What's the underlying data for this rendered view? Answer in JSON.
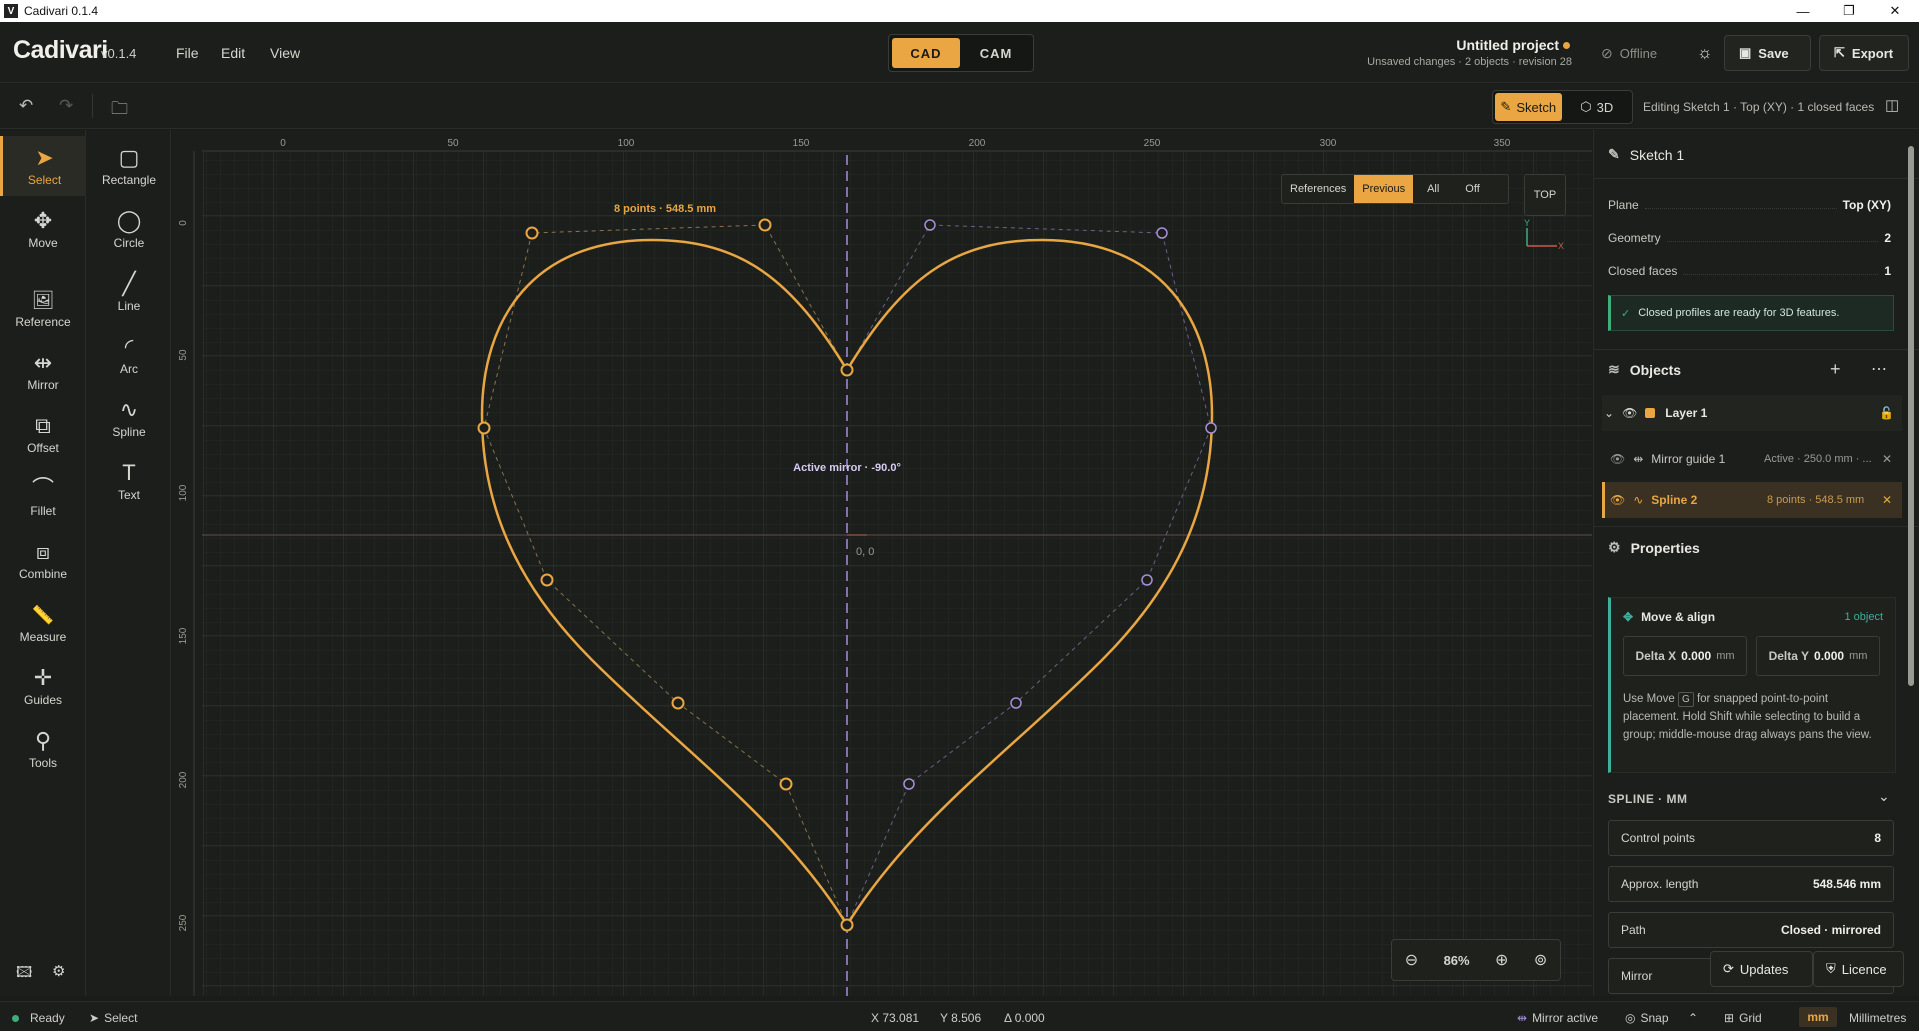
{
  "window": {
    "title": "Cadivari 0.1.4",
    "logo_letter": "V"
  },
  "app": {
    "name": "Cadivari",
    "version": "v0.1.4"
  },
  "menu": [
    "File",
    "Edit",
    "View"
  ],
  "mode": {
    "cad": "CAD",
    "cam": "CAM"
  },
  "project": {
    "title": "Untitled project",
    "subtitle": "Unsaved changes · 2 objects · revision 28"
  },
  "header_actions": {
    "offline": "Offline",
    "save": "Save",
    "export": "Export"
  },
  "view_switch": {
    "sketch": "Sketch",
    "three_d": "3D"
  },
  "editing_status": "Editing Sketch 1 · Top (XY) · 1 closed faces",
  "tools_primary": [
    {
      "label": "Select",
      "icon": "cursor-icon",
      "glyph": "➤"
    },
    {
      "label": "Move",
      "icon": "move-icon",
      "glyph": "✥"
    },
    {
      "label": "Reference",
      "icon": "image-add-icon",
      "glyph": "🖼"
    },
    {
      "label": "Mirror",
      "icon": "mirror-icon",
      "glyph": "⇹"
    },
    {
      "label": "Offset",
      "icon": "offset-icon",
      "glyph": "⧉"
    },
    {
      "label": "Fillet",
      "icon": "fillet-icon",
      "glyph": "⌒"
    },
    {
      "label": "Combine",
      "icon": "combine-icon",
      "glyph": "⧈"
    },
    {
      "label": "Measure",
      "icon": "ruler-icon",
      "glyph": "📏"
    },
    {
      "label": "Guides",
      "icon": "guides-icon",
      "glyph": "✛"
    },
    {
      "label": "Tools",
      "icon": "tools-icon",
      "glyph": "⚲"
    }
  ],
  "tools_shapes": [
    {
      "label": "Rectangle",
      "icon": "rectangle-icon",
      "glyph": "▢"
    },
    {
      "label": "Circle",
      "icon": "circle-icon",
      "glyph": "◯"
    },
    {
      "label": "Line",
      "icon": "line-icon",
      "glyph": "╱"
    },
    {
      "label": "Arc",
      "icon": "arc-icon",
      "glyph": "◜"
    },
    {
      "label": "Spline",
      "icon": "spline-icon",
      "glyph": "∿"
    },
    {
      "label": "Text",
      "icon": "text-icon",
      "glyph": "T"
    }
  ],
  "canvas": {
    "ruler_x": [
      "0",
      "50",
      "100",
      "150",
      "200",
      "250",
      "300",
      "350"
    ],
    "ruler_y": [
      "0",
      "50",
      "100",
      "150",
      "200",
      "250"
    ],
    "spline_label": "8 points · 548.5 mm",
    "mirror_label": "Active mirror · -90.0°",
    "origin_label": "0, 0",
    "reference_modes": [
      "References",
      "Previous",
      "All",
      "Off"
    ],
    "view_cube": "TOP",
    "axis_x": "X",
    "axis_y": "Y",
    "zoom": "86%"
  },
  "sketch_panel": {
    "title": "Sketch 1",
    "plane_label": "Plane",
    "plane_value": "Top (XY)",
    "geometry_label": "Geometry",
    "geometry_value": "2",
    "faces_label": "Closed faces",
    "faces_value": "1",
    "note": "Closed profiles are ready for 3D features."
  },
  "objects": {
    "title": "Objects",
    "layer": "Layer 1",
    "items": [
      {
        "name": "Mirror guide 1",
        "meta": "Active · 250.0 mm · ..."
      },
      {
        "name": "Spline 2",
        "meta": "8 points · 548.5 mm"
      }
    ]
  },
  "properties": {
    "title": "Properties",
    "move_align": "Move & align",
    "count": "1 object",
    "delta_x_label": "Delta X",
    "delta_x": "0.000",
    "delta_y_label": "Delta Y",
    "delta_y": "0.000",
    "unit": "mm",
    "help_pre": "Use Move",
    "help_key": "G",
    "help_post": "for snapped point-to-point placement. Hold Shift while selecting to build a group; middle-mouse drag always pans the view.",
    "section": "SPLINE · MM",
    "control_points_label": "Control points",
    "control_points": "8",
    "length_label": "Approx. length",
    "length": "548.546 mm",
    "path_label": "Path",
    "path": "Closed · mirrored",
    "mirror_label": "Mirror"
  },
  "bottom_right": {
    "updates": "Updates",
    "licence": "Licence"
  },
  "status": {
    "ready": "Ready",
    "tool": "Select",
    "x": "X 73.081",
    "y": "Y 8.506",
    "delta": "Δ 0.000",
    "mirror": "Mirror active",
    "snap": "Snap",
    "grid": "Grid",
    "unit": "mm",
    "unit_name": "Millimetres"
  },
  "colors": {
    "accent": "#e9a642",
    "violet": "#a98ed8",
    "teal": "#3fae9a"
  }
}
